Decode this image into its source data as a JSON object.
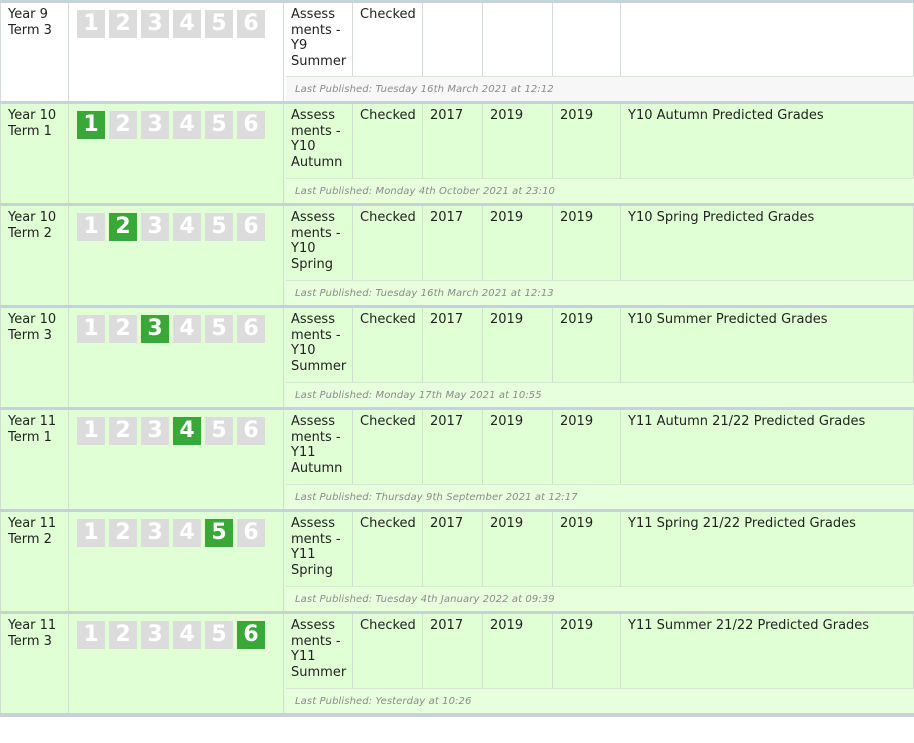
{
  "rows": [
    {
      "label": "Year 9\nTerm 3",
      "active_term": 0,
      "subject": "Assess\nments -\nY9\nSummer",
      "status": "Checked",
      "year1": "",
      "year2": "",
      "year3": "",
      "description": "",
      "last_published": "Last Published: Tuesday 16th March 2021 at 12:12",
      "theme": "white"
    },
    {
      "label": "Year 10\nTerm 1",
      "active_term": 1,
      "subject": "Assess\nments -\nY10\nAutumn",
      "status": "Checked",
      "year1": "2017",
      "year2": "2019",
      "year3": "2019",
      "description": "Y10 Autumn Predicted Grades",
      "last_published": "Last Published: Monday 4th October 2021 at 23:10",
      "theme": "green"
    },
    {
      "label": "Year 10\nTerm 2",
      "active_term": 2,
      "subject": "Assess\nments -\nY10\nSpring",
      "status": "Checked",
      "year1": "2017",
      "year2": "2019",
      "year3": "2019",
      "description": "Y10 Spring Predicted Grades",
      "last_published": "Last Published: Tuesday 16th March 2021 at 12:13",
      "theme": "green"
    },
    {
      "label": "Year 10\nTerm 3",
      "active_term": 3,
      "subject": "Assess\nments -\nY10\nSummer",
      "status": "Checked",
      "year1": "2017",
      "year2": "2019",
      "year3": "2019",
      "description": "Y10 Summer Predicted Grades",
      "last_published": "Last Published: Monday 17th May 2021 at 10:55",
      "theme": "green"
    },
    {
      "label": "Year 11\nTerm 1",
      "active_term": 4,
      "subject": "Assess\nments -\nY11\nAutumn",
      "status": "Checked",
      "year1": "2017",
      "year2": "2019",
      "year3": "2019",
      "description": "Y11 Autumn 21/22 Predicted Grades",
      "last_published": "Last Published: Thursday 9th September 2021 at 12:17",
      "theme": "green"
    },
    {
      "label": "Year 11\nTerm 2",
      "active_term": 5,
      "subject": "Assess\nments -\nY11\nSpring",
      "status": "Checked",
      "year1": "2017",
      "year2": "2019",
      "year3": "2019",
      "description": "Y11 Spring 21/22 Predicted Grades",
      "last_published": "Last Published: Tuesday 4th January 2022 at 09:39",
      "theme": "green"
    },
    {
      "label": "Year 11\nTerm 3",
      "active_term": 6,
      "subject": "Assess\nments -\nY11\nSummer",
      "status": "Checked",
      "year1": "2017",
      "year2": "2019",
      "year3": "2019",
      "description": "Y11 Summer 21/22 Predicted Grades",
      "last_published": "Last Published: Yesterday at 10:26",
      "theme": "green"
    }
  ],
  "term_numbers": [
    "1",
    "2",
    "3",
    "4",
    "5",
    "6"
  ],
  "colors": {
    "active_term": "#3aa838",
    "inactive_term": "#dcdcdc",
    "row_green": "#e0ffd4",
    "separator": "#c5d3d9"
  }
}
